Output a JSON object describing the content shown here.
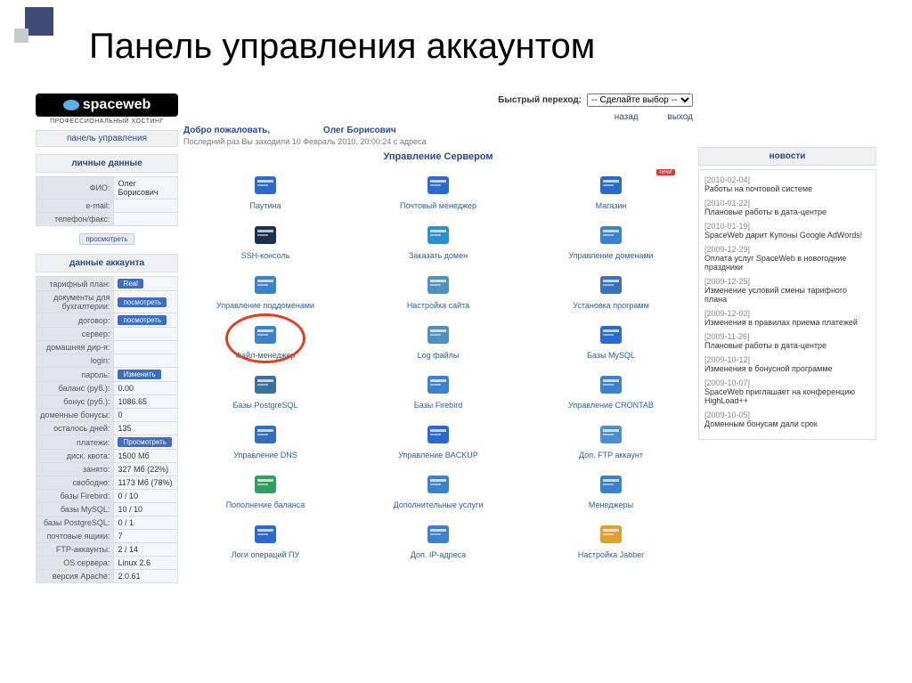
{
  "slide_title": "Панель управления аккаунтом",
  "logo_text": "spaceweb",
  "logo_sub": "ПРОФЕССИОНАЛЬНЫЙ ХОСТИНГ",
  "panel_link": "панель управления",
  "topbar": {
    "quick_jump": "Быстрый переход:",
    "select_placeholder": "-- Сделайте выбор --",
    "back": "назад",
    "exit": "выход"
  },
  "welcome": {
    "greet": "Добро пожаловать,",
    "name": "Олег Борисович",
    "last": "Последний раз Вы заходили 10 Февраль 2010, 20:00:24 с адреса"
  },
  "personal": {
    "title": "личные данные",
    "rows": [
      {
        "lbl": "ФИО:",
        "val": "Олег Борисович"
      },
      {
        "lbl": "e-mail:",
        "val": ""
      },
      {
        "lbl": "телефон/факс:",
        "val": ""
      }
    ],
    "view_btn": "просмотреть"
  },
  "account": {
    "title": "данные аккаунта",
    "rows": [
      {
        "lbl": "тарифный план:",
        "val": "",
        "btn": "Real"
      },
      {
        "lbl": "документы для бухгалтерии:",
        "val": "",
        "btn": "посмотреть"
      },
      {
        "lbl": "договор:",
        "val": "",
        "btn": "посмотреть"
      },
      {
        "lbl": "сервер:",
        "val": ""
      },
      {
        "lbl": "домашняя дир-я:",
        "val": ""
      },
      {
        "lbl": "login:",
        "val": ""
      },
      {
        "lbl": "пароль:",
        "val": "",
        "btn": "Изменить"
      },
      {
        "lbl": "баланс (руб.):",
        "val": "0.00"
      },
      {
        "lbl": "бонус (руб.):",
        "val": "1086.65"
      },
      {
        "lbl": "доменные бонусы:",
        "val": "0"
      },
      {
        "lbl": "осталось дней:",
        "val": "135"
      },
      {
        "lbl": "платежи:",
        "val": "",
        "btn": "Просмотреть"
      },
      {
        "lbl": "диск. квота:",
        "val": "1500 Мб"
      },
      {
        "lbl": "занято:",
        "val": "327 Мб (22%)"
      },
      {
        "lbl": "свободно:",
        "val": "1173 Мб (78%)"
      },
      {
        "lbl": "базы Firebird:",
        "val": "0 / 10"
      },
      {
        "lbl": "базы MySQL:",
        "val": "10 / 10"
      },
      {
        "lbl": "базы PostgreSQL:",
        "val": "0 / 1"
      },
      {
        "lbl": "почтовые ящики:",
        "val": "7"
      },
      {
        "lbl": "FTP-аккаунты:",
        "val": "2 / 14"
      },
      {
        "lbl": "OS сервера:",
        "val": "Linux 2.6"
      },
      {
        "lbl": "версия Apache:",
        "val": "2.0.61"
      }
    ]
  },
  "server": {
    "title": "Управление Сервером",
    "icons": [
      {
        "label": "Паутина",
        "color": "#2a6ad0",
        "new": false
      },
      {
        "label": "Почтовый менеджер",
        "color": "#2a6ad0",
        "new": false
      },
      {
        "label": "Магазин",
        "color": "#2a6ad0",
        "new": true
      },
      {
        "label": "SSH-консоль",
        "color": "#1a3050",
        "new": false
      },
      {
        "label": "Заказать домен",
        "color": "#2a90d0",
        "new": false
      },
      {
        "label": "Управление доменами",
        "color": "#3a82d0",
        "new": false
      },
      {
        "label": "Управление поддоменами",
        "color": "#3a82d0",
        "new": false
      },
      {
        "label": "Настройка сайта",
        "color": "#5090c0",
        "new": false
      },
      {
        "label": "Установка программ",
        "color": "#3a70c0",
        "new": false
      },
      {
        "label": "Файл-менеджер",
        "color": "#3a82d0",
        "new": false,
        "highlight": true
      },
      {
        "label": "Log файлы",
        "color": "#5090c0",
        "new": false
      },
      {
        "label": "Базы MySQL",
        "color": "#2a6ad0",
        "new": false
      },
      {
        "label": "Базы PostgreSQL",
        "color": "#3a70a0",
        "new": false
      },
      {
        "label": "Базы Firebird",
        "color": "#3a82d0",
        "new": false
      },
      {
        "label": "Управление CRONTAB",
        "color": "#3a82d0",
        "new": false
      },
      {
        "label": "Управление DNS",
        "color": "#3070c0",
        "new": false
      },
      {
        "label": "Управление BACKUP",
        "color": "#2a6ad0",
        "new": false
      },
      {
        "label": "Доп. FTP аккаунт",
        "color": "#4a90d0",
        "new": false
      },
      {
        "label": "Пополнение баланса",
        "color": "#30a060",
        "new": false
      },
      {
        "label": "Дополнительные услуги",
        "color": "#3a82d0",
        "new": false
      },
      {
        "label": "Менеджеры",
        "color": "#3a82d0",
        "new": false
      },
      {
        "label": "Логи операций ПУ",
        "color": "#2a6ad0",
        "new": false
      },
      {
        "label": "Доп. IP-адреса",
        "color": "#3a82d0",
        "new": false
      },
      {
        "label": "Настройка Jabber",
        "color": "#e0a030",
        "new": false
      }
    ]
  },
  "news": {
    "title": "новости",
    "items": [
      {
        "date": "[2010-02-04]",
        "text": "Работы на почтовой системе"
      },
      {
        "date": "[2010-01-22]",
        "text": "Плановые работы в дата-центре"
      },
      {
        "date": "[2010-01-19]",
        "text": "SpaceWeb дарит Купоны Google AdWords!"
      },
      {
        "date": "[2009-12-29]",
        "text": "Оплата услуг SpaceWeb в новогодние праздники"
      },
      {
        "date": "[2009-12-25]",
        "text": "Изменение условий смены тарифного плана"
      },
      {
        "date": "[2009-12-02]",
        "text": "Изменения в правилах приема платежей"
      },
      {
        "date": "[2009-11-26]",
        "text": "Плановые работы в дата-центре"
      },
      {
        "date": "[2009-10-12]",
        "text": "Изменения в бонусной программе"
      },
      {
        "date": "[2009-10-07]",
        "text": "SpaceWeb приглашает на конференцию HighLoad++"
      },
      {
        "date": "[2009-10-05]",
        "text": "Доменным бонусам дали срок"
      }
    ]
  },
  "new_badge_text": "new!"
}
